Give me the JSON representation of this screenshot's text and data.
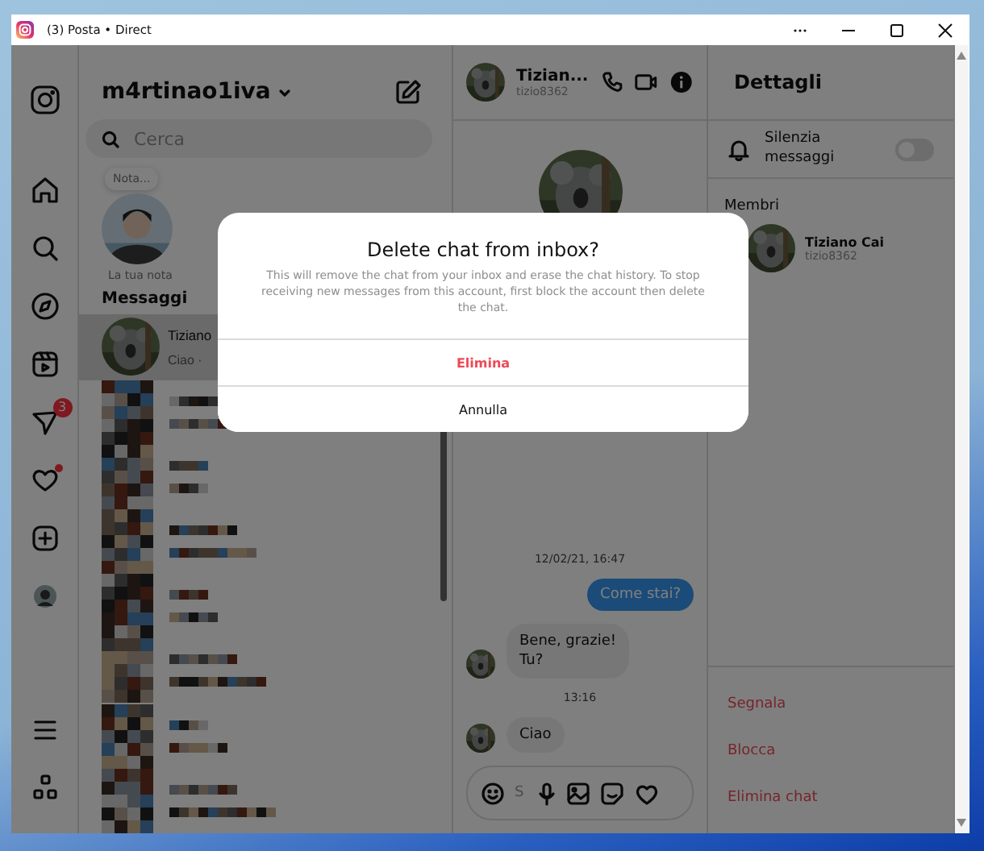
{
  "window": {
    "title": "(3) Posta • Direct"
  },
  "nav": {
    "messages_badge": "3",
    "activity_dot": true
  },
  "inbox": {
    "account": "m4rtinao1iva",
    "search": {
      "placeholder": "Cerca"
    },
    "note": {
      "bubble": "Nota...",
      "caption": "La tua nota"
    },
    "section_title": "Messaggi",
    "chats": [
      {
        "kind": "contact",
        "name": "Tiziano",
        "preview": "Ciao ·",
        "selected": true
      },
      {
        "kind": "redacted",
        "selected": false
      },
      {
        "kind": "redacted",
        "selected": false
      },
      {
        "kind": "redacted",
        "selected": false
      },
      {
        "kind": "redacted",
        "selected": false
      },
      {
        "kind": "redacted",
        "selected": false
      },
      {
        "kind": "redacted",
        "selected": false
      },
      {
        "kind": "redacted",
        "selected": false
      }
    ]
  },
  "conversation": {
    "name": "Tizian...",
    "username": "tizio8362",
    "messages": [
      {
        "kind": "timestamp",
        "text": "12/02/21, 16:47"
      },
      {
        "kind": "sent",
        "text": "Come stai?"
      },
      {
        "kind": "received",
        "text": "Bene, grazie!\nTu?"
      },
      {
        "kind": "timestamp",
        "text": "13:16"
      },
      {
        "kind": "received",
        "text": "Ciao"
      }
    ],
    "composer": {
      "placeholder": "S"
    }
  },
  "details": {
    "title": "Dettagli",
    "mute": {
      "label": "Silenzia messaggi",
      "on": false
    },
    "members_title": "Membri",
    "members": [
      {
        "name": "Tiziano Cai",
        "username": "tizio8362"
      }
    ],
    "actions": [
      "Segnala",
      "Blocca",
      "Elimina chat"
    ]
  },
  "dialog": {
    "title": "Delete chat from inbox?",
    "body": "This will remove the chat from your inbox and erase the chat history. To stop receiving new messages from this account, first block the account then delete the chat.",
    "buttons": [
      {
        "label": "Elimina",
        "kind": "destructive"
      },
      {
        "label": "Annulla",
        "kind": "normal"
      }
    ]
  }
}
